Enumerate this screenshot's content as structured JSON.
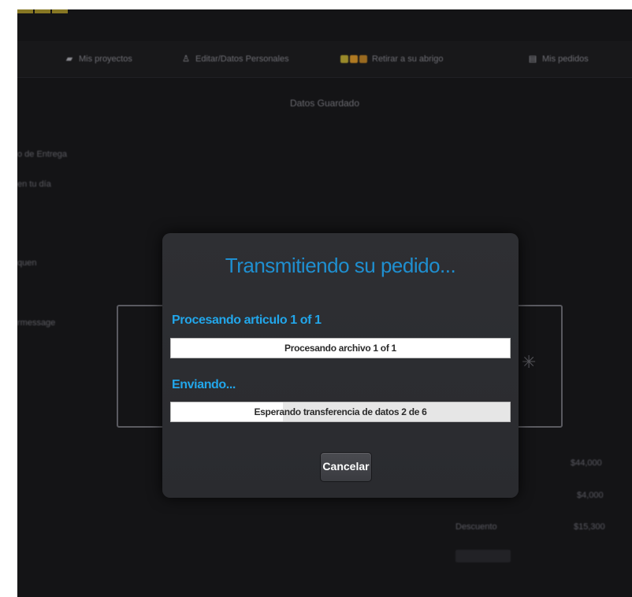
{
  "header": {
    "nav": [
      {
        "label": "Mis proyectos",
        "icon": "folder-icon"
      },
      {
        "label": "Editar/Datos Personales",
        "icon": "user-icon"
      },
      {
        "label": "Retirar a su abrigo",
        "icon": "steps-icon"
      },
      {
        "label": "Mis pedidos",
        "icon": "clipboard-icon"
      }
    ],
    "page_heading": "Datos Guardado"
  },
  "sidebar_fragments": [
    "o de Entrega",
    "en tu día",
    "quen",
    "rmessage",
    ""
  ],
  "summary": {
    "row1_value": "$44,000",
    "row2_value": "$4,000",
    "row3_label": "Descuento",
    "row3_value": "$15,300",
    "row4_label": "",
    "row4_value": ""
  },
  "dialog": {
    "title": "Transmitiendo su pedido...",
    "item_label": "Procesando articulo 1 of 1",
    "item_progress_text": "Procesando archivo 1 of 1",
    "item_progress": 1.0,
    "sending_label": "Enviando...",
    "sending_progress_text": "Esperando transferencia de datos 2 de 6",
    "sending_progress": 0.33,
    "cancel_label": "Cancelar"
  },
  "colors": {
    "accent": "#22a6ea",
    "dialog_bg": "#2e2f33",
    "screen_bg": "#141416"
  }
}
